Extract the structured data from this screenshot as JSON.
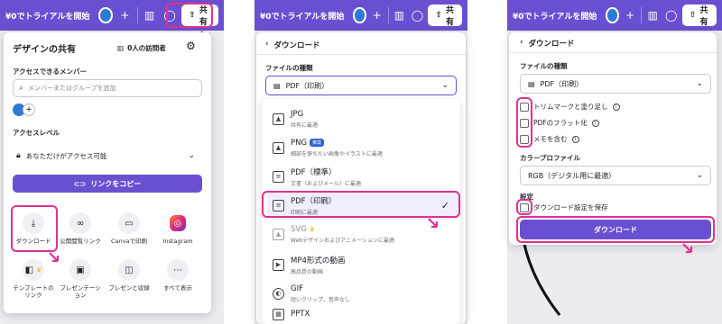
{
  "topbar": {
    "trial_label": "¥0でトライアルを開始",
    "plus_icon": "plus-icon",
    "chart_icon": "chart-icon",
    "comment_icon": "comment-icon",
    "share_label": "共有"
  },
  "share_panel": {
    "title": "デザインの共有",
    "visitors": "0人の訪問者",
    "access_members_label": "アクセスできるメンバー",
    "member_search_placeholder": "メンバーまたはグループを追加",
    "access_level_label": "アクセスレベル",
    "access_level_value": "あなただけがアクセス可能",
    "copy_link_label": "リンクをコピー",
    "options": [
      {
        "label": "ダウンロード",
        "icon": "download-icon"
      },
      {
        "label": "公開閲覧リンク",
        "icon": "link-icon"
      },
      {
        "label": "Canvaで印刷",
        "icon": "truck-icon"
      },
      {
        "label": "Instagram",
        "icon": "instagram-icon"
      },
      {
        "label": "テンプレートのリンク",
        "icon": "template-icon"
      },
      {
        "label": "プレゼンテーション",
        "icon": "present-icon"
      },
      {
        "label": "プレゼンと収録",
        "icon": "record-icon"
      },
      {
        "label": "すべて表示",
        "icon": "more-icon"
      }
    ]
  },
  "download_panel": {
    "back_title": "ダウンロード",
    "file_type_label": "ファイルの種類",
    "selected_type": "PDF（印刷）",
    "file_types": [
      {
        "name": "JPG",
        "desc": "共有に最適"
      },
      {
        "name": "PNG",
        "badge": "推奨",
        "desc": "細部を保ちたい画像やイラストに最適"
      },
      {
        "name": "PDF（標準）",
        "desc": "文書（およびメール）に最適"
      },
      {
        "name": "PDF（印刷）",
        "desc": "印刷に最適"
      },
      {
        "name": "SVG",
        "desc": "Webデザインおよびアニメーションに最適"
      },
      {
        "name": "MP4形式の動画",
        "desc": "高品質の動画"
      },
      {
        "name": "GIF",
        "desc": "短いクリップ、音声なし"
      },
      {
        "name": "PPTX",
        "desc": ""
      }
    ]
  },
  "settings_panel": {
    "back_title": "ダウンロード",
    "file_type_label": "ファイルの種類",
    "selected_type": "PDF（印刷）",
    "checkboxes": [
      "トリムマークと塗り足し",
      "PDFのフラット化",
      "メモを含む"
    ],
    "color_profile_label": "カラープロファイル",
    "color_profile_value": "RGB（デジタル用に最適）",
    "settings_label": "設定",
    "save_settings_label": "ダウンロード設定を保存",
    "download_button": "ダウンロード"
  },
  "colors": {
    "brand_purple": "#6b4fd1",
    "highlight_pink": "#e0318f"
  }
}
